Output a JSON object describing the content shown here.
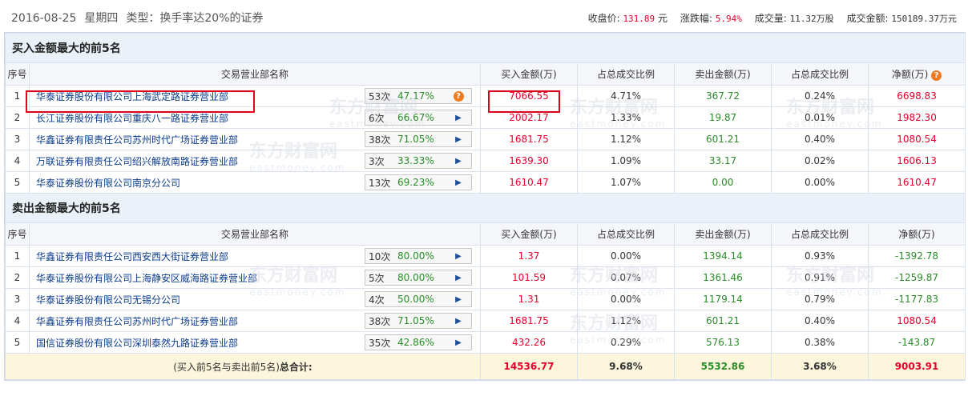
{
  "header": {
    "date": "2016-08-25",
    "weekday": "星期四",
    "type_label": "类型：换手率达20%的证券",
    "close_label": "收盘价:",
    "close_value": "131.89",
    "close_unit": "元",
    "change_label": "涨跌幅:",
    "change_value": "5.94%",
    "volume_label": "成交量:",
    "volume_value": "11.32万股",
    "amount_label": "成交金额:",
    "amount_value": "150189.37万元"
  },
  "columns": {
    "idx": "序号",
    "name": "交易营业部名称",
    "buy": "买入金额(万)",
    "buy_ratio": "占总成交比例",
    "sell": "卖出金额(万)",
    "sell_ratio": "占总成交比例",
    "net": "净额(万)"
  },
  "buy_section": {
    "title": "买入金额最大的前5名",
    "rows": [
      {
        "idx": "1",
        "name": "华泰证券股份有限公司上海武定路证券营业部",
        "count": "53次",
        "pct": "47.17%",
        "buy": "7066.55",
        "buy_ratio": "4.71%",
        "sell": "367.72",
        "sell_ratio": "0.24%",
        "net": "6698.83"
      },
      {
        "idx": "2",
        "name": "长江证券股份有限公司重庆八一路证券营业部",
        "count": "6次",
        "pct": "66.67%",
        "buy": "2002.17",
        "buy_ratio": "1.33%",
        "sell": "19.87",
        "sell_ratio": "0.01%",
        "net": "1982.30"
      },
      {
        "idx": "3",
        "name": "华鑫证券有限责任公司苏州时代广场证券营业部",
        "count": "38次",
        "pct": "71.05%",
        "buy": "1681.75",
        "buy_ratio": "1.12%",
        "sell": "601.21",
        "sell_ratio": "0.40%",
        "net": "1080.54"
      },
      {
        "idx": "4",
        "name": "万联证券有限责任公司绍兴解放南路证券营业部",
        "count": "3次",
        "pct": "33.33%",
        "buy": "1639.30",
        "buy_ratio": "1.09%",
        "sell": "33.17",
        "sell_ratio": "0.02%",
        "net": "1606.13"
      },
      {
        "idx": "5",
        "name": "华泰证券股份有限公司南京分公司",
        "count": "13次",
        "pct": "69.23%",
        "buy": "1610.47",
        "buy_ratio": "1.07%",
        "sell": "0.00",
        "sell_ratio": "0.00%",
        "net": "1610.47"
      }
    ]
  },
  "sell_section": {
    "title": "卖出金额最大的前5名",
    "rows": [
      {
        "idx": "1",
        "name": "华鑫证券有限责任公司西安西大街证券营业部",
        "count": "10次",
        "pct": "80.00%",
        "buy": "1.37",
        "buy_ratio": "0.00%",
        "sell": "1394.14",
        "sell_ratio": "0.93%",
        "net": "-1392.78"
      },
      {
        "idx": "2",
        "name": "华泰证券股份有限公司上海静安区威海路证券营业部",
        "count": "5次",
        "pct": "80.00%",
        "buy": "101.59",
        "buy_ratio": "0.07%",
        "sell": "1361.46",
        "sell_ratio": "0.91%",
        "net": "-1259.87"
      },
      {
        "idx": "3",
        "name": "华泰证券股份有限公司无锡分公司",
        "count": "4次",
        "pct": "50.00%",
        "buy": "1.31",
        "buy_ratio": "0.00%",
        "sell": "1179.14",
        "sell_ratio": "0.79%",
        "net": "-1177.83"
      },
      {
        "idx": "4",
        "name": "华鑫证券有限责任公司苏州时代广场证券营业部",
        "count": "38次",
        "pct": "71.05%",
        "buy": "1681.75",
        "buy_ratio": "1.12%",
        "sell": "601.21",
        "sell_ratio": "0.40%",
        "net": "1080.54"
      },
      {
        "idx": "5",
        "name": "国信证券股份有限公司深圳泰然九路证券营业部",
        "count": "35次",
        "pct": "42.86%",
        "buy": "432.26",
        "buy_ratio": "0.29%",
        "sell": "576.13",
        "sell_ratio": "0.38%",
        "net": "-143.87"
      }
    ]
  },
  "footer": {
    "label_prefix": "(买入前5名与卖出前5名)",
    "label_total": "总合计:",
    "buy": "14536.77",
    "buy_ratio": "9.68%",
    "sell": "5532.86",
    "sell_ratio": "3.68%",
    "net": "9003.91"
  },
  "icons": {
    "help": "question-badge-icon",
    "arrow": "play-arrow-icon"
  },
  "colors": {
    "positive": "#e4002b",
    "negative": "#2a8c2a",
    "link": "#0b3c8c",
    "highlight_box": "#e0001b"
  },
  "watermark": {
    "brand": "东方财富网",
    "domain": "eastmoney.com"
  }
}
